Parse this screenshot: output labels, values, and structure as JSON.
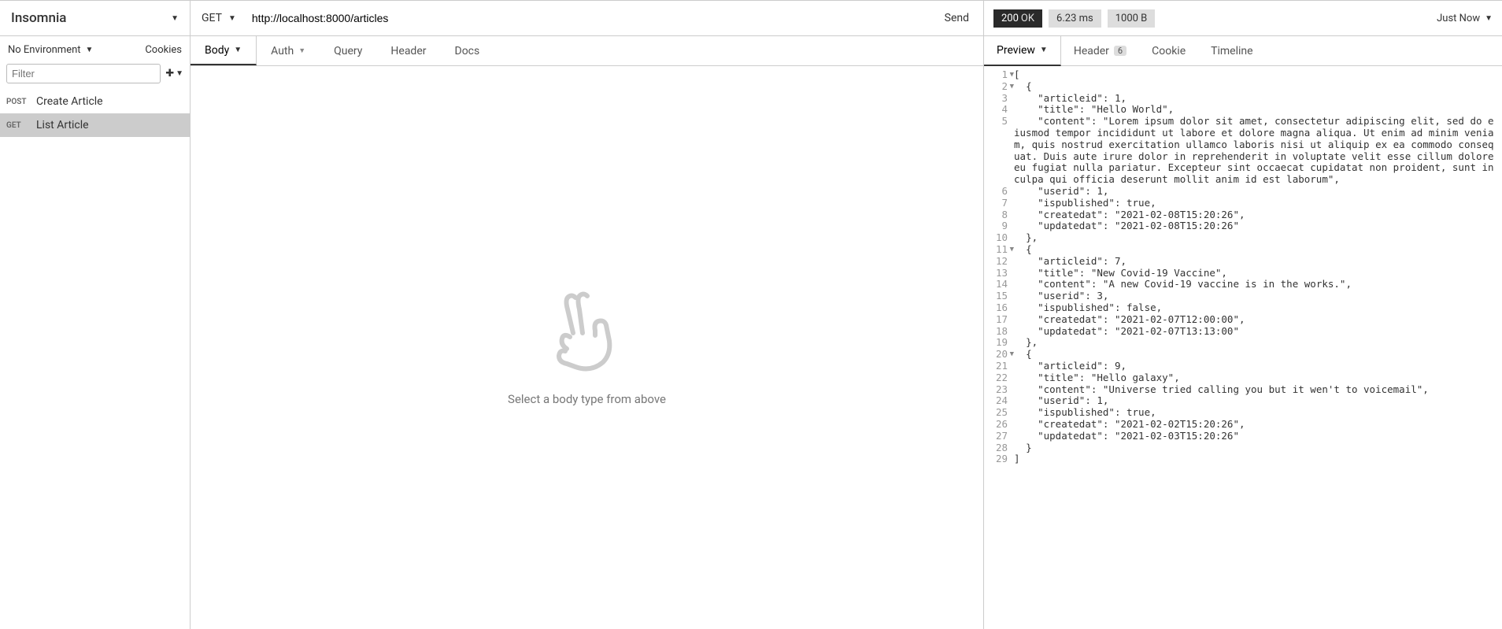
{
  "app": {
    "title": "Insomnia"
  },
  "sidebar": {
    "env_label": "No Environment",
    "cookies_label": "Cookies",
    "filter_placeholder": "Filter",
    "requests": [
      {
        "method": "POST",
        "name": "Create Article"
      },
      {
        "method": "GET",
        "name": "List Article"
      }
    ]
  },
  "request": {
    "method": "GET",
    "url": "http://localhost:8000/articles",
    "send_label": "Send",
    "tabs": {
      "body": "Body",
      "auth": "Auth",
      "query": "Query",
      "header": "Header",
      "docs": "Docs"
    },
    "body_placeholder": "Select a body type from above"
  },
  "response": {
    "status_code": "200",
    "status_text": "OK",
    "time": "6.23 ms",
    "size": "1000 B",
    "timestamp": "Just Now",
    "tabs": {
      "preview": "Preview",
      "header": "Header",
      "header_count": "6",
      "cookie": "Cookie",
      "timeline": "Timeline"
    },
    "code_lines": [
      {
        "n": "1",
        "fold": true,
        "text": "["
      },
      {
        "n": "2",
        "fold": true,
        "text": "  {"
      },
      {
        "n": "3",
        "text": "    \"articleid\": 1,"
      },
      {
        "n": "4",
        "text": "    \"title\": \"Hello World\","
      },
      {
        "n": "5",
        "text": "    \"content\": \"Lorem ipsum dolor sit amet, consectetur adipiscing elit, sed do eiusmod tempor incididunt ut labore et dolore magna aliqua. Ut enim ad minim veniam, quis nostrud exercitation ullamco laboris nisi ut aliquip ex ea commodo consequat. Duis aute irure dolor in reprehenderit in voluptate velit esse cillum dolore eu fugiat nulla pariatur. Excepteur sint occaecat cupidatat non proident, sunt in culpa qui officia deserunt mollit anim id est laborum\","
      },
      {
        "n": "6",
        "text": "    \"userid\": 1,"
      },
      {
        "n": "7",
        "text": "    \"ispublished\": true,"
      },
      {
        "n": "8",
        "text": "    \"createdat\": \"2021-02-08T15:20:26\","
      },
      {
        "n": "9",
        "text": "    \"updatedat\": \"2021-02-08T15:20:26\""
      },
      {
        "n": "10",
        "text": "  },"
      },
      {
        "n": "11",
        "fold": true,
        "text": "  {"
      },
      {
        "n": "12",
        "text": "    \"articleid\": 7,"
      },
      {
        "n": "13",
        "text": "    \"title\": \"New Covid-19 Vaccine\","
      },
      {
        "n": "14",
        "text": "    \"content\": \"A new Covid-19 vaccine is in the works.\","
      },
      {
        "n": "15",
        "text": "    \"userid\": 3,"
      },
      {
        "n": "16",
        "text": "    \"ispublished\": false,"
      },
      {
        "n": "17",
        "text": "    \"createdat\": \"2021-02-07T12:00:00\","
      },
      {
        "n": "18",
        "text": "    \"updatedat\": \"2021-02-07T13:13:00\""
      },
      {
        "n": "19",
        "text": "  },"
      },
      {
        "n": "20",
        "fold": true,
        "text": "  {"
      },
      {
        "n": "21",
        "text": "    \"articleid\": 9,"
      },
      {
        "n": "22",
        "text": "    \"title\": \"Hello galaxy\","
      },
      {
        "n": "23",
        "text": "    \"content\": \"Universe tried calling you but it wen't to voicemail\","
      },
      {
        "n": "24",
        "text": "    \"userid\": 1,"
      },
      {
        "n": "25",
        "text": "    \"ispublished\": true,"
      },
      {
        "n": "26",
        "text": "    \"createdat\": \"2021-02-02T15:20:26\","
      },
      {
        "n": "27",
        "text": "    \"updatedat\": \"2021-02-03T15:20:26\""
      },
      {
        "n": "28",
        "text": "  }"
      },
      {
        "n": "29",
        "text": "]"
      }
    ]
  }
}
